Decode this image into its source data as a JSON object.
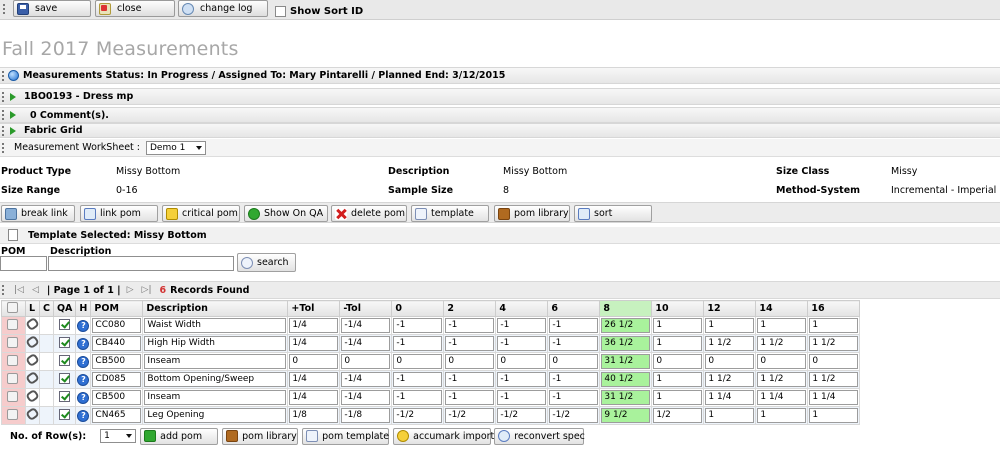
{
  "toolbar": {
    "save": "save",
    "close": "close",
    "change_log": "change log",
    "show_sort_id": "Show Sort ID"
  },
  "page_title": "Fall 2017 Measurements",
  "sections": {
    "measurements": "Measurements  Status: In Progress / Assigned To: Mary Pintarelli / Planned End: 3/12/2015",
    "style": "1BO0193 - Dress mp",
    "comments": "0 Comment(s).",
    "fabric_grid": "Fabric Grid"
  },
  "worksheet": {
    "label": "Measurement WorkSheet :",
    "value": "Demo 1"
  },
  "info": {
    "product_type_label": "Product Type",
    "product_type": "Missy Bottom",
    "description_label": "Description",
    "description": "Missy Bottom",
    "size_class_label": "Size Class",
    "size_class": "Missy",
    "size_range_label": "Size Range",
    "size_range": "0-16",
    "sample_size_label": "Sample Size",
    "sample_size": "8",
    "method_label": "Method-System",
    "method": "Incremental - Imperial"
  },
  "actions": {
    "break_link": "break link",
    "link_pom": "link pom",
    "critical_pom": "critical pom",
    "show_on_qa": "Show On QA",
    "delete_pom": "delete pom",
    "template": "template",
    "pom_library": "pom library",
    "sort": "sort"
  },
  "template_selected": "Template Selected: Missy Bottom",
  "search": {
    "pom_label": "POM",
    "description_label": "Description",
    "button": "search"
  },
  "pager": {
    "first": "|◁",
    "prev": "◁",
    "page_text": "| Page 1 of 1 |",
    "next": "▷",
    "last": "▷|",
    "count": "6",
    "records_label": "Records Found"
  },
  "grid": {
    "headers": [
      "L",
      "C",
      "QA",
      "H",
      "POM",
      "Description",
      "+Tol",
      "-Tol",
      "0",
      "2",
      "4",
      "6",
      "8",
      "10",
      "12",
      "14",
      "16"
    ],
    "highlight_color": "#a9f29c",
    "rows": [
      {
        "pom": "CC080",
        "desc": "Waist Width",
        "ptol": "1/4",
        "ntol": "-1/4",
        "s0": "-1",
        "s2": "-1",
        "s4": "-1",
        "s6": "-1",
        "s8": "26 1/2",
        "s10": "1",
        "s12": "1",
        "s14": "1",
        "s16": "1"
      },
      {
        "pom": "CB440",
        "desc": "High Hip Width",
        "ptol": "1/4",
        "ntol": "-1/4",
        "s0": "-1",
        "s2": "-1",
        "s4": "-1",
        "s6": "-1",
        "s8": "36 1/2",
        "s10": "1",
        "s12": "1 1/2",
        "s14": "1 1/2",
        "s16": "1 1/2"
      },
      {
        "pom": "CB500",
        "desc": "Inseam",
        "ptol": "0",
        "ntol": "0",
        "s0": "0",
        "s2": "0",
        "s4": "0",
        "s6": "0",
        "s8": "31 1/2",
        "s10": "0",
        "s12": "0",
        "s14": "0",
        "s16": "0"
      },
      {
        "pom": "CD085",
        "desc": "Bottom Opening/Sweep",
        "ptol": "1/4",
        "ntol": "-1/4",
        "s0": "-1",
        "s2": "-1",
        "s4": "-1",
        "s6": "-1",
        "s8": "40 1/2",
        "s10": "1",
        "s12": "1 1/2",
        "s14": "1 1/2",
        "s16": "1 1/2"
      },
      {
        "pom": "CB500",
        "desc": "Inseam",
        "ptol": "1/4",
        "ntol": "-1/4",
        "s0": "-1",
        "s2": "-1",
        "s4": "-1",
        "s6": "-1",
        "s8": "31 1/2",
        "s10": "1",
        "s12": "1 1/4",
        "s14": "1 1/4",
        "s16": "1 1/4"
      },
      {
        "pom": "CN465",
        "desc": "Leg Opening",
        "ptol": "1/8",
        "ntol": "-1/8",
        "s0": "-1/2",
        "s2": "-1/2",
        "s4": "-1/2",
        "s6": "-1/2",
        "s8": "9 1/2",
        "s10": "1/2",
        "s12": "1",
        "s14": "1",
        "s16": "1"
      }
    ]
  },
  "footer": {
    "rows_label": "No. of Row(s):",
    "rows_value": "1",
    "add_pom": "add pom",
    "pom_library": "pom library",
    "pom_template": "pom template",
    "accumark_import": "accumark import",
    "reconvert_spec": "reconvert spec"
  }
}
